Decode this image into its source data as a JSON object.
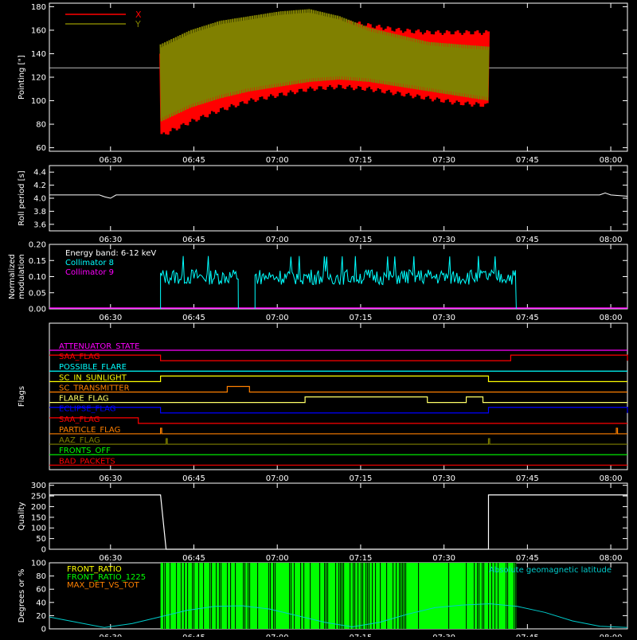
{
  "colors": {
    "background": "#000000",
    "axis": "#ffffff",
    "x_trace": "#ff0000",
    "y_trace": "#808000",
    "collimator8": "#00ffff",
    "collimator9": "#ff00ff",
    "front_ratio_bars": "#00ff00",
    "geomag": "#00cccc"
  },
  "time_ticks": [
    "06:30",
    "06:45",
    "07:00",
    "07:15",
    "07:30",
    "07:45",
    "08:00"
  ],
  "chart_data": [
    {
      "type": "line",
      "panel": "pointing",
      "ylabel": "Pointing [\"]",
      "ylim": [
        57,
        183
      ],
      "yticks": [
        60,
        80,
        100,
        120,
        140,
        160,
        180
      ],
      "reference_line": 128,
      "data_start": "06:39",
      "data_end": "07:38",
      "series": [
        {
          "name": "X",
          "color": "#ff0000",
          "upper": [
            140,
            150,
            158,
            164,
            168,
            170,
            168,
            164,
            160,
            158,
            158,
            158
          ],
          "lower": [
            70,
            82,
            92,
            100,
            105,
            110,
            112,
            110,
            106,
            102,
            98,
            96
          ]
        },
        {
          "name": "Y",
          "color": "#808000",
          "upper": [
            148,
            160,
            168,
            172,
            176,
            178,
            172,
            162,
            156,
            150,
            148,
            146
          ],
          "lower": [
            82,
            94,
            102,
            108,
            112,
            116,
            118,
            116,
            112,
            108,
            104,
            100
          ]
        }
      ]
    },
    {
      "type": "line",
      "panel": "roll",
      "ylabel": "Roll period [s]",
      "ylim": [
        3.5,
        4.5
      ],
      "yticks": [
        3.6,
        3.8,
        4.0,
        4.2,
        4.4
      ],
      "value": 4.05
    },
    {
      "type": "line",
      "panel": "modulation",
      "ylabel": "Normalized modulation",
      "ylim": [
        0,
        0.2
      ],
      "yticks": [
        0.0,
        0.05,
        0.1,
        0.15,
        0.2
      ],
      "annotation": "Energy band: 6-12 keV",
      "series": [
        {
          "name": "Collimator 8",
          "color": "#00ffff",
          "segments": [
            [
              "06:39",
              "06:53"
            ],
            [
              "06:56",
              "07:43"
            ]
          ],
          "level": 0.1
        },
        {
          "name": "Collimator 9",
          "color": "#ff00ff",
          "level": 0.0
        }
      ]
    },
    {
      "type": "line",
      "panel": "flags",
      "ylabel": "Flags",
      "flags": [
        {
          "name": "ATTENUATOR_STATE",
          "color": "#ff00ff",
          "high": []
        },
        {
          "name": "SAA_FLAG",
          "color": "#ff0000",
          "high": [
            [
              "06:19",
              "06:39"
            ],
            [
              "07:42",
              "08:03"
            ]
          ]
        },
        {
          "name": "POSSIBLE_FLARE",
          "color": "#00ffff",
          "high": []
        },
        {
          "name": "SC_IN_SUNLIGHT",
          "color": "#ffff00",
          "high": [
            [
              "06:39",
              "07:38"
            ]
          ]
        },
        {
          "name": "SC_TRANSMITTER",
          "color": "#ff8000",
          "high": [
            [
              "06:51",
              "06:55"
            ]
          ]
        },
        {
          "name": "FLARE_FLAG",
          "color": "#ffff66",
          "high": [
            [
              "07:05",
              "07:27"
            ],
            [
              "07:34",
              "07:37"
            ]
          ]
        },
        {
          "name": "ECLIPSE_FLAG",
          "color": "#0000ff",
          "high": [
            [
              "06:19",
              "06:39"
            ],
            [
              "07:38",
              "08:03"
            ]
          ]
        },
        {
          "name": "SAA_FLAG",
          "color": "#ff0000",
          "high": [
            [
              "06:19",
              "06:35"
            ]
          ]
        },
        {
          "name": "PARTICLE_FLAG",
          "color": "#ff8000",
          "spikes": [
            "06:39",
            "08:01"
          ]
        },
        {
          "name": "AAZ_FLAG",
          "color": "#808000",
          "spikes": [
            "06:40",
            "07:38"
          ]
        },
        {
          "name": "FRONTS_OFF",
          "color": "#00ff00",
          "high": []
        },
        {
          "name": "BAD_PACKETS",
          "color": "#ff0000",
          "high": []
        }
      ]
    },
    {
      "type": "line",
      "panel": "quality",
      "ylabel": "Quality",
      "ylim": [
        0,
        310
      ],
      "yticks": [
        0,
        50,
        100,
        150,
        200,
        250,
        300
      ],
      "steps": [
        [
          "06:19",
          255
        ],
        [
          "06:39",
          255
        ],
        [
          "06:40",
          0
        ],
        [
          "07:38",
          0
        ],
        [
          "07:38",
          255
        ],
        [
          "08:03",
          255
        ]
      ]
    },
    {
      "type": "line",
      "panel": "front_ratio",
      "ylabel": "Degrees or %",
      "ylim": [
        0,
        100
      ],
      "yticks": [
        0,
        20,
        40,
        60,
        80,
        100
      ],
      "legend": [
        "FRONT_RATIO",
        "FRONT_RATIO_1225",
        "MAX_DET_VS_TOT"
      ],
      "legend_colors": [
        "#ffff00",
        "#00ff00",
        "#ff8000"
      ],
      "right_label": "Absolute geomagnetic latitude",
      "bars_range": [
        "06:39",
        "07:43"
      ],
      "geomag": [
        18,
        10,
        2,
        8,
        18,
        28,
        34,
        35,
        30,
        20,
        10,
        3,
        10,
        22,
        32,
        36,
        38,
        34,
        25,
        12,
        4,
        2
      ]
    }
  ]
}
